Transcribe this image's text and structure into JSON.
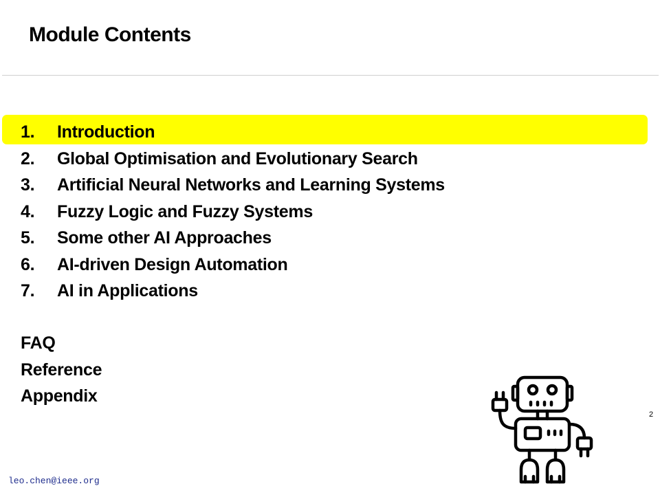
{
  "slide": {
    "title": "Module Contents",
    "page_number": "2",
    "footer_email": "leo.chen@ieee.org",
    "highlight_color": "#ffff00"
  },
  "toc": [
    {
      "num": "1.",
      "label": "Introduction",
      "highlighted": true
    },
    {
      "num": "2.",
      "label": "Global Optimisation and Evolutionary Search"
    },
    {
      "num": "3.",
      "label": "Artificial Neural Networks and Learning Systems"
    },
    {
      "num": "4.",
      "label": "Fuzzy Logic and Fuzzy Systems"
    },
    {
      "num": "5.",
      "label": "Some other AI Approaches"
    },
    {
      "num": "6.",
      "label": "AI-driven Design Automation"
    },
    {
      "num": "7.",
      "label": "AI in Applications"
    }
  ],
  "extras": [
    "FAQ",
    "Reference",
    "Appendix"
  ],
  "icons": {
    "illustration": "robot-icon"
  }
}
